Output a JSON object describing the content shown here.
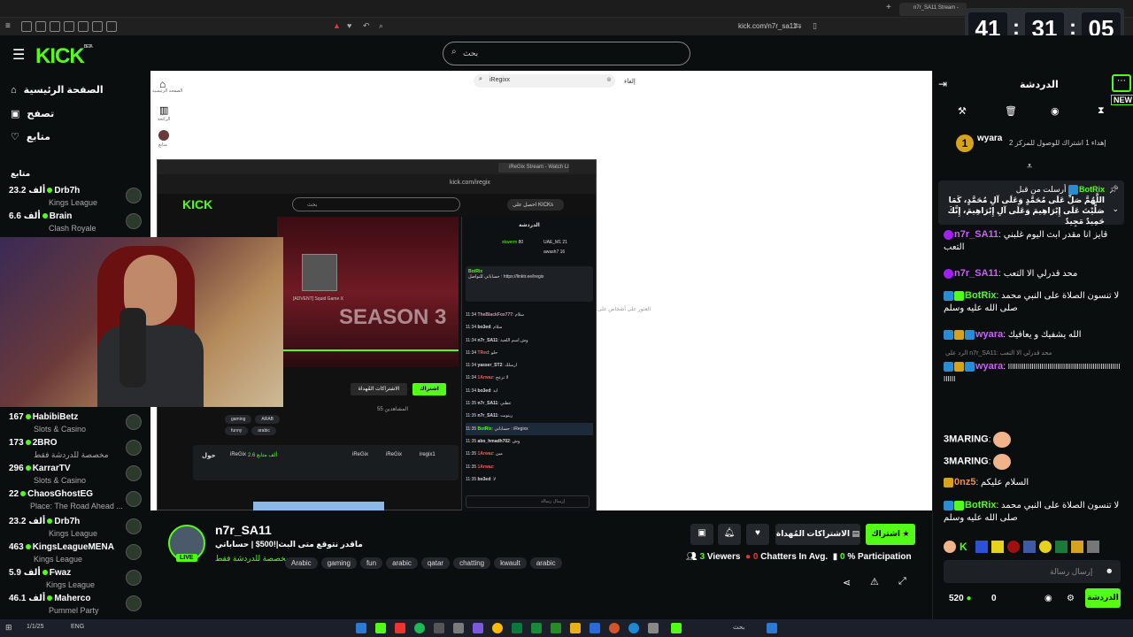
{
  "browser": {
    "tab_title": "n7r_SA11 Stream -",
    "url": "kick.com/n7r_sa11"
  },
  "clock": {
    "h": "41",
    "m": "31",
    "s": "05"
  },
  "header": {
    "logo": "KICK",
    "logo_badge": "BETA",
    "search_placeholder": "بحث"
  },
  "sidebar": {
    "nav": [
      {
        "label": "الصفحة الرئيسية",
        "icon": "home-icon"
      },
      {
        "label": "تصفح",
        "icon": "browse-icon"
      },
      {
        "label": "متابع",
        "icon": "heart-icon"
      }
    ],
    "following_title": "متابع",
    "channels_top": [
      {
        "viewers": "23.2 ألف",
        "name": "Drb7h",
        "category": "Kings League"
      },
      {
        "viewers": "6.6 ألف",
        "name": "Brain",
        "category": "Clash Royale"
      }
    ],
    "channels": [
      {
        "viewers": "167",
        "name": "HabibiBetz",
        "category": "Slots & Casino"
      },
      {
        "viewers": "173",
        "name": "2BRO",
        "category": "مخصصة للدردشة فقط"
      },
      {
        "viewers": "296",
        "name": "KarrarTV",
        "category": "Slots & Casino"
      },
      {
        "viewers": "22",
        "name": "ChaosGhostEG",
        "category": "Place: The Road Ahead ..."
      },
      {
        "viewers": "23.2 ألف",
        "name": "Drb7h",
        "category": "Kings League"
      },
      {
        "viewers": "463",
        "name": "KingsLeagueMENA",
        "category": "Kings League"
      },
      {
        "viewers": "5.9 ألف",
        "name": "Fwaz",
        "category": "Kings League"
      },
      {
        "viewers": "46.1 ألف",
        "name": "Maherco",
        "category": "Pummel Party"
      }
    ]
  },
  "main_shot": {
    "search_value": "iRegixx",
    "cancel": "إلغاء",
    "home": "الصفحة الرئيسية",
    "trending": "الرائجة",
    "following": "متابع",
    "caption": "العثور على أشخاص على"
  },
  "inner": {
    "url": "kick.com/iregix",
    "tab": "iReGix Stream - Watch Live on",
    "search": "بحث",
    "get_kicks": "احصل على KICKs",
    "chat_title": "الدردشة",
    "video_title": "[ADVENT] Squid Game X",
    "season_text": "SEASON 3",
    "subscribe": "اشتراك",
    "gift_subs": "الاشتراكات المُهداة",
    "viewers": "55 المشاهدين",
    "tags": [
      "gaming",
      "ARAB",
      "funny",
      "arabic"
    ],
    "channel_name": "iReGix",
    "followers": "2.6 ألف متابع",
    "about": "حول",
    "socials": [
      "iReGix",
      "iReGix",
      "iregix1"
    ],
    "leaderboard": [
      {
        "name": "xkwerm",
        "value": "80"
      },
      {
        "name": "UAE_M1",
        "value": "21"
      },
      {
        "name": "awash7",
        "value": "16"
      }
    ],
    "pinned_user": "BotRix",
    "pinned_text": "حساباتي للتواصل : https://linktr.ee/iregix",
    "messages": [
      {
        "time": "11:34",
        "user": "TheBlackFox777",
        "text": "سلام"
      },
      {
        "time": "11:34",
        "user": "bo3ed",
        "text": "سلام"
      },
      {
        "time": "11:34",
        "user": "n7r_SA11",
        "text": "وش اسم اللعبة"
      },
      {
        "time": "11:34",
        "user": "TRed",
        "text": "حلو"
      },
      {
        "time": "11:34",
        "user": "yasser_ST2",
        "text": "ارسلك"
      },
      {
        "time": "11:34",
        "user": "1Arwaz",
        "text": "لا تزعج"
      },
      {
        "time": "11:34",
        "user": "bo3ed",
        "text": "ابد"
      },
      {
        "time": "11:35",
        "user": "n7r_SA11",
        "text": "عطني"
      },
      {
        "time": "11:35",
        "user": "n7r_SA11",
        "text": "ريتويت"
      },
      {
        "time": "11:35",
        "user": "BotRix",
        "text": "حساباتي : iRegixx"
      },
      {
        "time": "11:35",
        "user": "abo_hmadh702",
        "text": "وش"
      },
      {
        "time": "11:35",
        "user": "1Arwaz",
        "text": "مين"
      },
      {
        "time": "11:35",
        "user": "1Arwaz",
        "text": ""
      },
      {
        "time": "11:35",
        "user": "bo3ed",
        "text": "لا"
      }
    ],
    "send_placeholder": "إرسال رسالة"
  },
  "stream": {
    "channel": "n7r_SA11",
    "title": "ماقدر نتوقع متى البث|!500$ | حساباتي",
    "category": "مخصصة للدردشة فقط",
    "tags": [
      "Arabic",
      "gaming",
      "fun",
      "arabic",
      "qatar",
      "chatting",
      "kwault",
      "arabic"
    ],
    "live": "LIVE",
    "subscribe": "اشتراك",
    "gift_subs": "الاشتراكات المُهداة",
    "viewers": "3",
    "viewers_label": "Viewers",
    "chatters": "0",
    "chatters_label": "Chatters In Avg.",
    "participation": "0",
    "participation_label": "% Participation"
  },
  "chat": {
    "title": "الدردشة",
    "new_label": "NEW",
    "top_gifter_name": "wyara",
    "top_gifter_count": "1",
    "top_gifter_text": "إهداء 1 اشتراك للوصول للمركز 2",
    "pinned_user": "BotRix",
    "pinned_by": "أرسلت من قبل",
    "pinned_text": "اللَّهُمَّ صَلِّ عَلَى مُحَمَّدٍ وَعَلَى آلِ مُحَمَّدٍ، كَمَا صَلَّيْتَ عَلَى إِبْرَاهِيمَ وَعَلَى آلِ إِبْرَاهِيمَ، إِنَّكَ حَمِيدٌ مَجِيدٌ",
    "messages": [
      {
        "user": "n7r_SA11",
        "text": "قايز انا مقدر ابث اليوم غلبني التعب",
        "color": "#d35bff"
      },
      {
        "user": "n7r_SA11",
        "text": "محد قدرلي الا التعب",
        "color": "#d35bff"
      },
      {
        "user": "BotRix",
        "text": "لا تنسون الصلاة على النبي محمد صلى الله عليه وسلم",
        "color": "#53fc18"
      },
      {
        "user": "wyara",
        "text": "الله يشفيك و يعافيك",
        "color": "#d35bff"
      },
      {
        "user": "wyara",
        "text": "ااااااااااااااااااااااااااااااااااااااااااااااااااااااااااااااا",
        "color": "#d35bff",
        "reply": "الرد على n7r_SA11: محد قدرلي الا التعب"
      },
      {
        "user": "3MARING",
        "text": "",
        "color": "#fff"
      },
      {
        "user": "3MARING",
        "text": "",
        "color": "#fff"
      },
      {
        "user": "0nz5",
        "text": "السلام عليكم",
        "color": "#ff8a3a"
      },
      {
        "user": "BotRix",
        "text": "لا تنسون الصلاة على النبي محمد صلى الله عليه وسلم",
        "color": "#53fc18"
      }
    ],
    "send_placeholder": "إرسال رسالة",
    "points": "520",
    "zero": "0",
    "chat_button": "الدردشة"
  },
  "taskbar": {
    "lang": "ENG",
    "time": "1/1/25",
    "search": "بحث"
  },
  "colors": {
    "accent": "#53fc18",
    "bg": "#0b0e0f"
  }
}
